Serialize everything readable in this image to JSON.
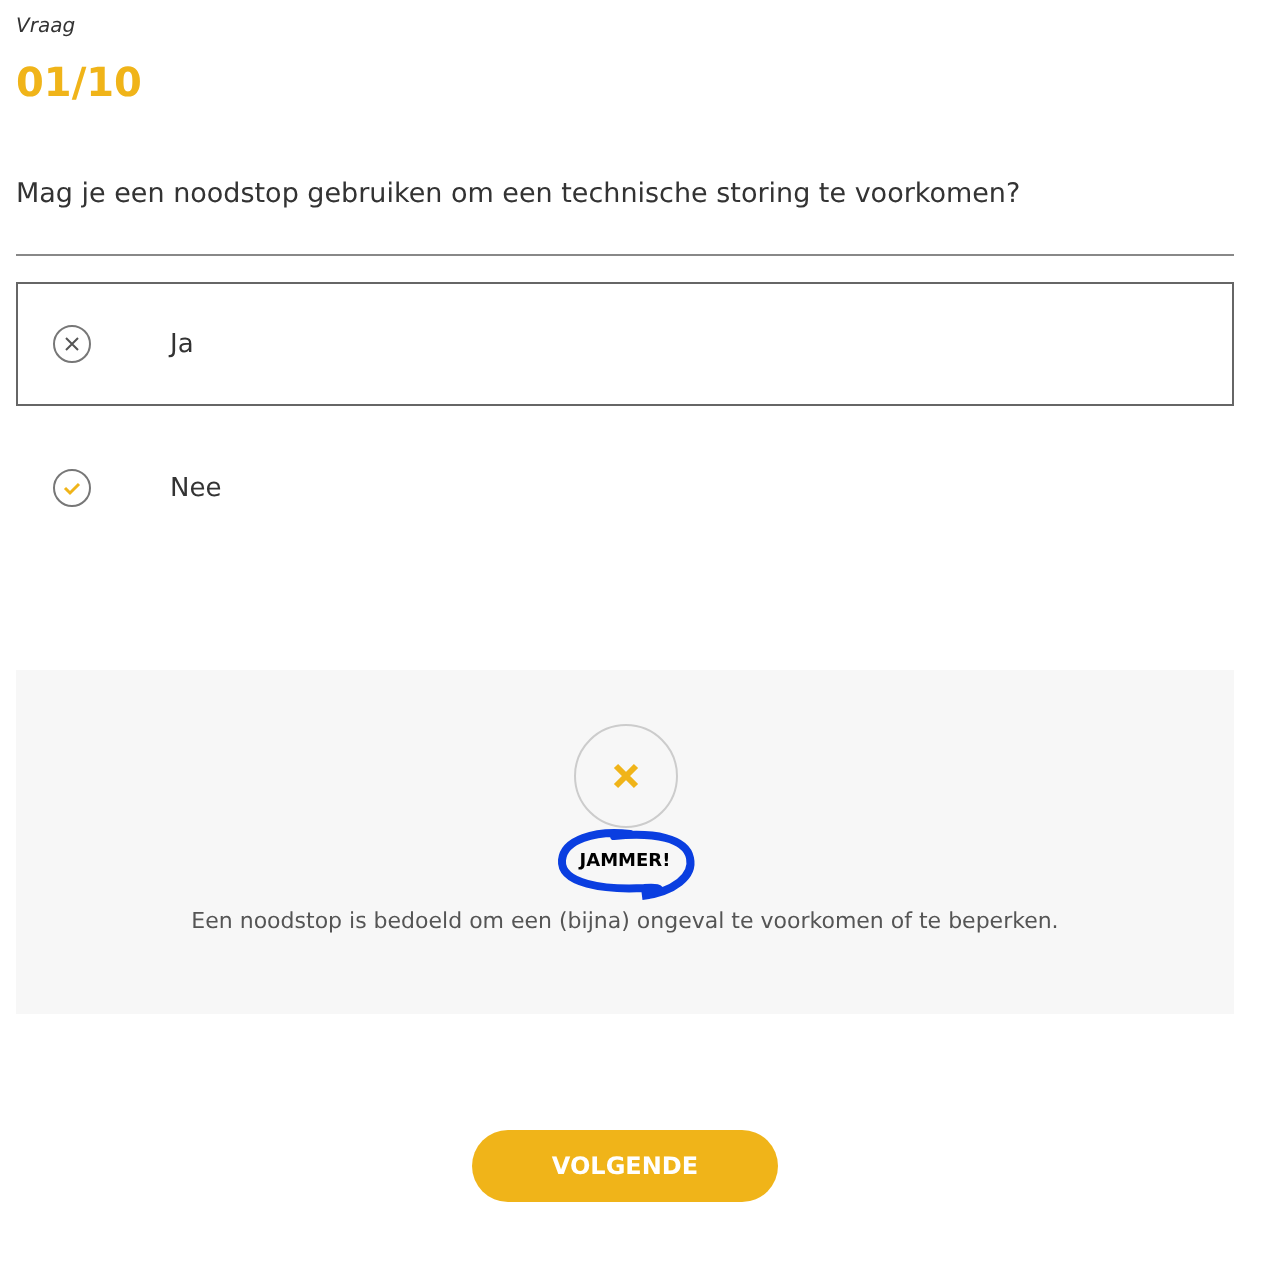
{
  "label": "Vraag",
  "counter": "01/10",
  "question": "Mag je een noodstop gebruiken om een technische storing te voorkomen?",
  "options": [
    {
      "label": "Ja",
      "kind": "wrong",
      "selected": true
    },
    {
      "label": "Nee",
      "kind": "correct",
      "selected": false
    }
  ],
  "feedback": {
    "kind": "wrong",
    "title": "JAMMER!",
    "text": "Een noodstop is bedoeld om een (bijna) ongeval te voorkomen of te beperken."
  },
  "button": "VOLGENDE"
}
